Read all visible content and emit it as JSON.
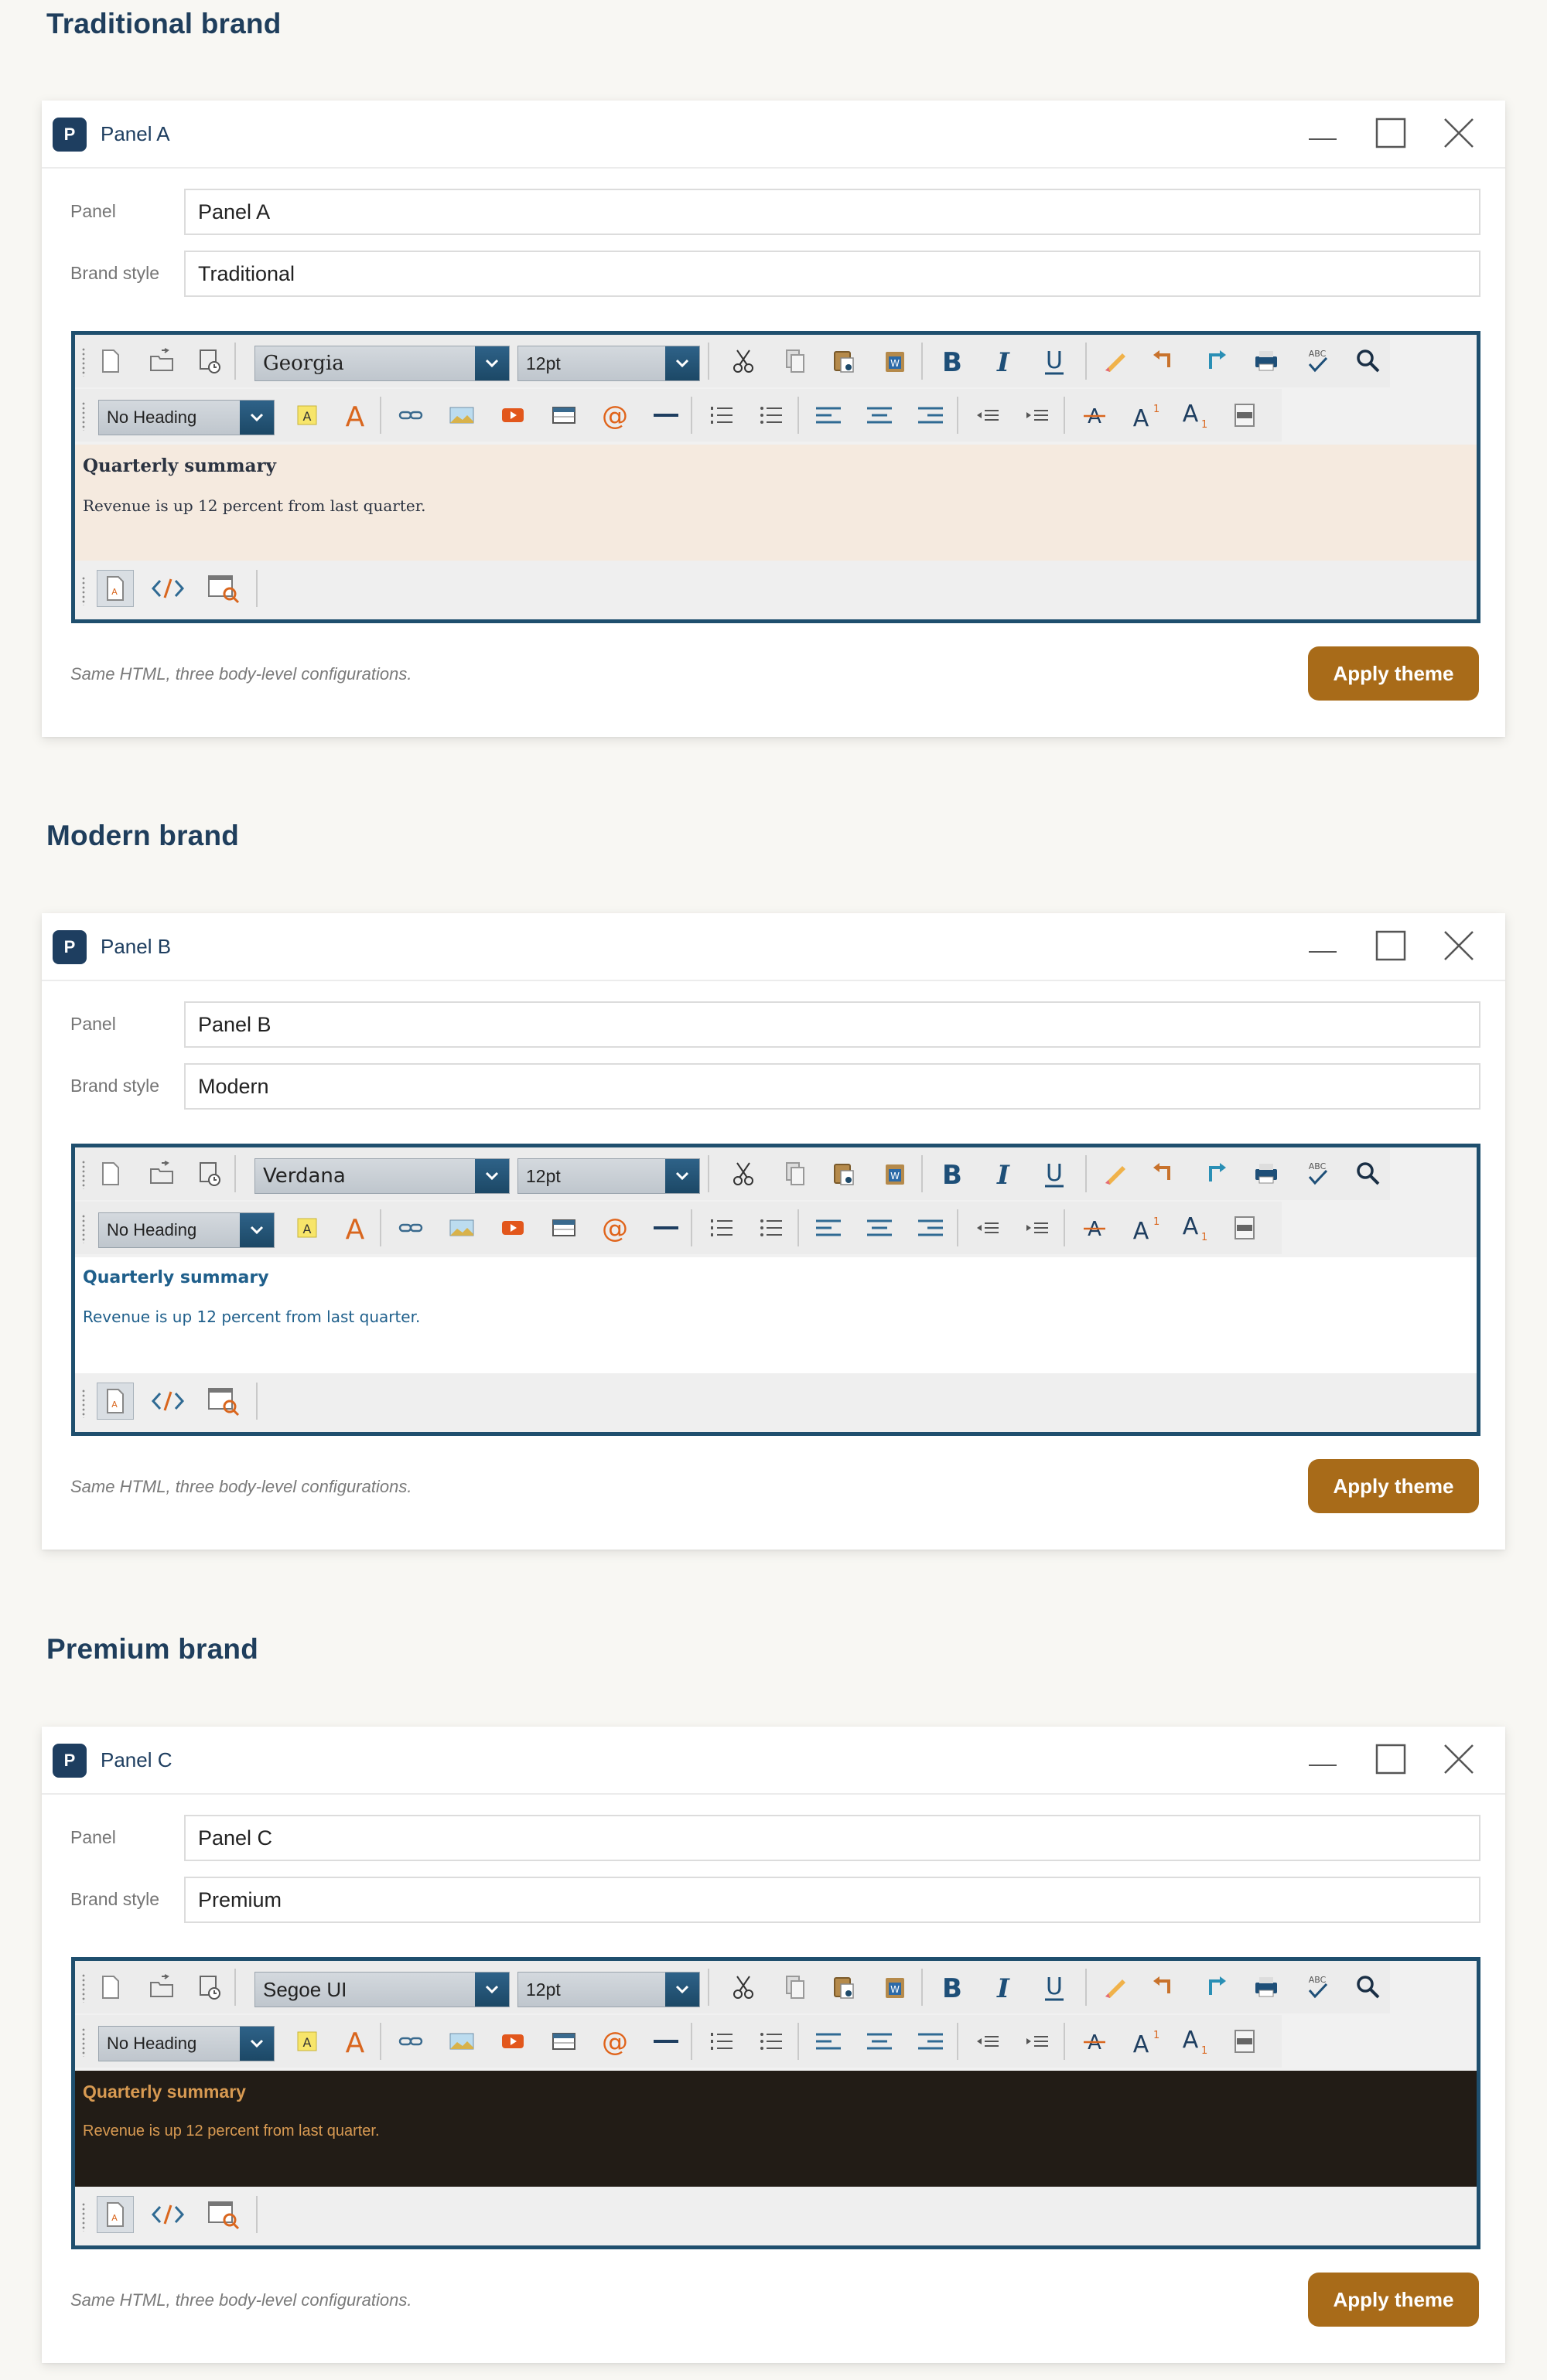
{
  "sections": [
    {
      "heading": "Traditional brand",
      "window_title": "Panel A",
      "app_icon_letter": "P",
      "panel_label": "Panel",
      "panel_value": "Panel A",
      "style_label": "Brand style",
      "style_value": "Traditional",
      "font_combo": "Georgia",
      "size_combo": "12pt",
      "heading_combo": "No Heading",
      "content_heading": "Quarterly summary",
      "content_text": "Revenue is up 12 percent from last quarter.",
      "note": "Same HTML, three body-level configurations.",
      "apply_label": "Apply theme"
    },
    {
      "heading": "Modern brand",
      "window_title": "Panel B",
      "app_icon_letter": "P",
      "panel_label": "Panel",
      "panel_value": "Panel B",
      "style_label": "Brand style",
      "style_value": "Modern",
      "font_combo": "Verdana",
      "size_combo": "12pt",
      "heading_combo": "No Heading",
      "content_heading": "Quarterly summary",
      "content_text": "Revenue is up 12 percent from last quarter.",
      "note": "Same HTML, three body-level configurations.",
      "apply_label": "Apply theme"
    },
    {
      "heading": "Premium brand",
      "window_title": "Panel C",
      "app_icon_letter": "P",
      "panel_label": "Panel",
      "panel_value": "Panel C",
      "style_label": "Brand style",
      "style_value": "Premium",
      "font_combo": "Segoe UI",
      "size_combo": "12pt",
      "heading_combo": "No Heading",
      "content_heading": "Quarterly summary",
      "content_text": "Revenue is up 12 percent from last quarter.",
      "note": "Same HTML, three body-level configurations.",
      "apply_label": "Apply theme"
    }
  ],
  "toolbar1_icons": [
    "new-document-icon",
    "open-folder-icon",
    "save-icon",
    "cut-icon",
    "copy-icon",
    "paste-icon",
    "paste-from-word-icon",
    "bold-icon",
    "italic-icon",
    "underline-icon",
    "format-stripper-icon",
    "undo-icon",
    "redo-icon",
    "print-icon",
    "spellcheck-icon",
    "find-icon"
  ],
  "toolbar2_icons": [
    "highlight-color-icon",
    "font-color-icon",
    "link-icon",
    "image-icon",
    "media-icon",
    "table-icon",
    "at-symbol-icon",
    "horizontal-rule-icon",
    "ordered-list-icon",
    "unordered-list-icon",
    "align-left-icon",
    "align-center-icon",
    "align-right-icon",
    "outdent-icon",
    "indent-icon",
    "strikethrough-icon",
    "superscript-icon",
    "subscript-icon",
    "css-class-icon"
  ],
  "bottom_icons": [
    "design-mode-icon",
    "html-mode-icon",
    "preview-mode-icon"
  ],
  "brand_icons": {
    "A": "A",
    "abc": "ABC",
    "at": "@"
  },
  "colors": {
    "accent": "#a86b19",
    "editor_border": "#1f4f6e",
    "traditional_bg": "#f5eadf",
    "modern_text": "#1f5f8b",
    "premium_bg": "#221c16",
    "premium_text": "#d89a52"
  }
}
